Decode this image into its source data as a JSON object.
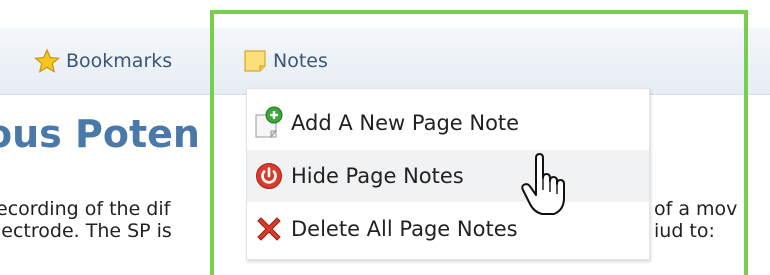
{
  "toolbar": {
    "bookmarks_label": "Bookmarks",
    "notes_label": "Notes"
  },
  "page": {
    "title": "ous Poten",
    "line1": "ecording of the dif",
    "line2": "lectrode. The SP is",
    "line1_right": "of a mov",
    "line2_right": "iud to:"
  },
  "notes_menu": {
    "items": [
      {
        "label": "Add A New Page Note",
        "icon": "add-note-icon"
      },
      {
        "label": "Hide Page Notes",
        "icon": "power-icon"
      },
      {
        "label": "Delete All Page Notes",
        "icon": "delete-x-icon"
      }
    ],
    "hovered_item": "Hide Page Notes"
  },
  "colors": {
    "highlight_frame": "#77d04d",
    "title": "#4a78a8",
    "toolbar_text": "#3b5578",
    "delete_red": "#d93b2b",
    "add_green": "#3aa83a"
  }
}
